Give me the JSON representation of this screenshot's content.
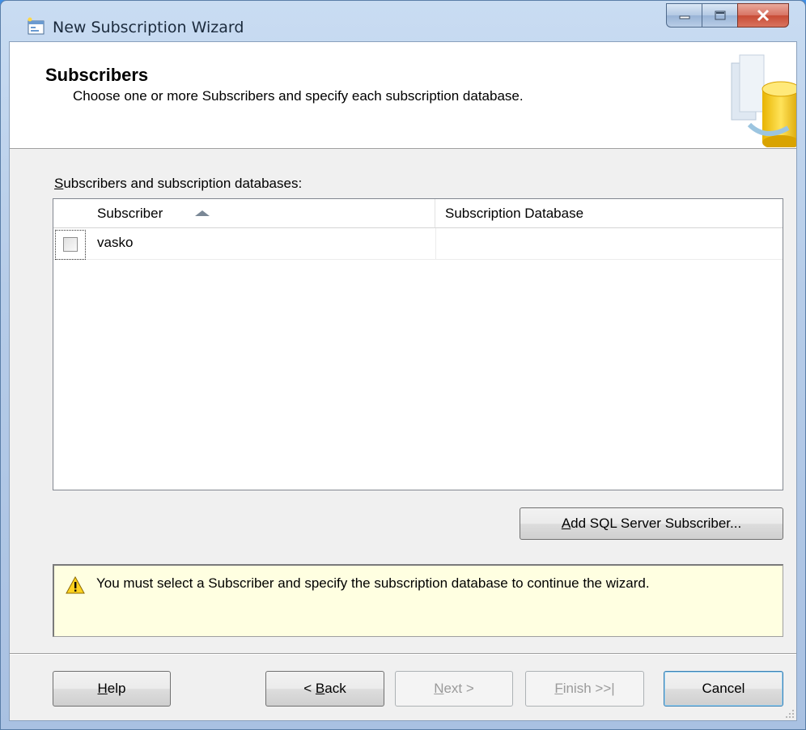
{
  "window": {
    "title": "New Subscription Wizard",
    "icon": "wizard-app-icon",
    "controls": [
      "minimize-icon",
      "maximize-icon",
      "close-icon"
    ]
  },
  "header": {
    "title": "Subscribers",
    "description": "Choose one or more Subscribers and specify each subscription database."
  },
  "list": {
    "label_mnemonic": "S",
    "label_rest": "ubscribers and subscription databases:",
    "columns": [
      "Subscriber",
      "Subscription Database"
    ],
    "sort": {
      "column": "Subscriber",
      "direction": "ascending"
    },
    "rows": [
      {
        "checked": false,
        "subscriber": "vasko",
        "database": ""
      }
    ]
  },
  "add_button": {
    "mnemonic": "A",
    "rest": "dd SQL Server Subscriber..."
  },
  "warning": {
    "icon": "warning-icon",
    "text": "You must select a Subscriber and specify the subscription database to continue the wizard."
  },
  "buttons": {
    "help": {
      "mnemonic": "H",
      "rest": "elp",
      "enabled": true
    },
    "back": {
      "prefix": "< ",
      "mnemonic": "B",
      "rest": "ack",
      "enabled": true
    },
    "next": {
      "mnemonic": "N",
      "rest": "ext >",
      "enabled": false
    },
    "finish": {
      "mnemonic": "F",
      "rest": "inish >>|",
      "enabled": false
    },
    "cancel": {
      "label": "Cancel",
      "enabled": true
    }
  },
  "colors": {
    "desktop": "#2a76d6",
    "warning_bg": "#ffffe1",
    "client_bg": "#f0f0f0"
  }
}
